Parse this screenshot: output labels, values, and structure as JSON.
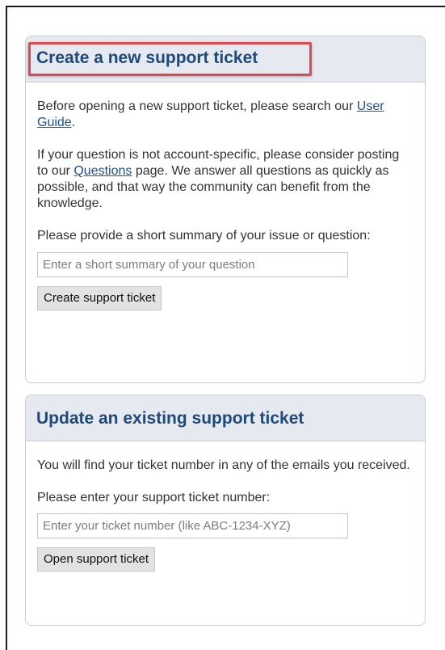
{
  "create_panel": {
    "title": "Create a new support ticket",
    "intro_prefix": "Before opening a new support ticket, please search our ",
    "user_guide_link": "User Guide",
    "intro_suffix": ".",
    "questions_prefix": "If your question is not account-specific, please consider posting to our ",
    "questions_link": "Questions",
    "questions_suffix": " page. We answer all questions as quickly as possible, and that way the community can benefit from the knowledge.",
    "summary_label": "Please provide a short summary of your issue or question:",
    "summary_placeholder": "Enter a short summary of your question",
    "button_label": "Create support ticket"
  },
  "update_panel": {
    "title": "Update an existing support ticket",
    "info_text": "You will find your ticket number in any of the emails you received.",
    "ticket_label": "Please enter your support ticket number:",
    "ticket_placeholder": "Enter your ticket number (like ABC-1234-XYZ)",
    "button_label": "Open support ticket"
  },
  "colors": {
    "title": "#1c4a7a",
    "header_bg": "#e6e9ef",
    "highlight": "#e2474d",
    "link": "#1a4f9c"
  }
}
